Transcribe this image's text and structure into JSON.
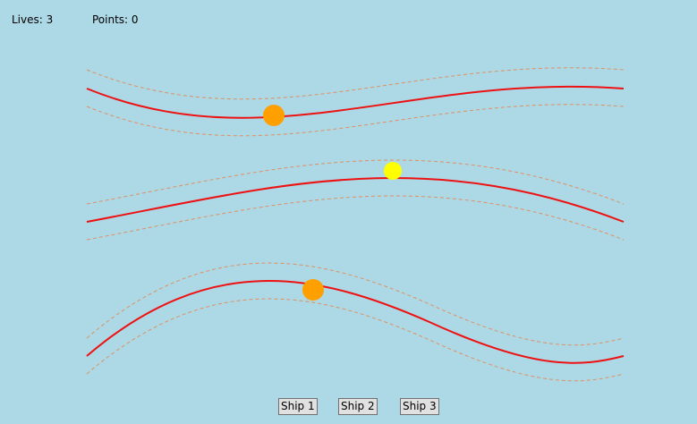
{
  "hud": {
    "lives_label": "Lives: 3",
    "points_label": "Points: 0"
  },
  "buttons": [
    {
      "label": "Ship 1"
    },
    {
      "label": "Ship 2"
    },
    {
      "label": "Ship 3"
    }
  ],
  "colors": {
    "background": "#add8e6",
    "path": "#ee1111",
    "guide": "#e09060",
    "ship_idle": "#ffa000",
    "ship_selected": "#ffff00"
  },
  "ships": [
    {
      "state": "idle"
    },
    {
      "state": "selected"
    },
    {
      "state": "idle"
    }
  ]
}
